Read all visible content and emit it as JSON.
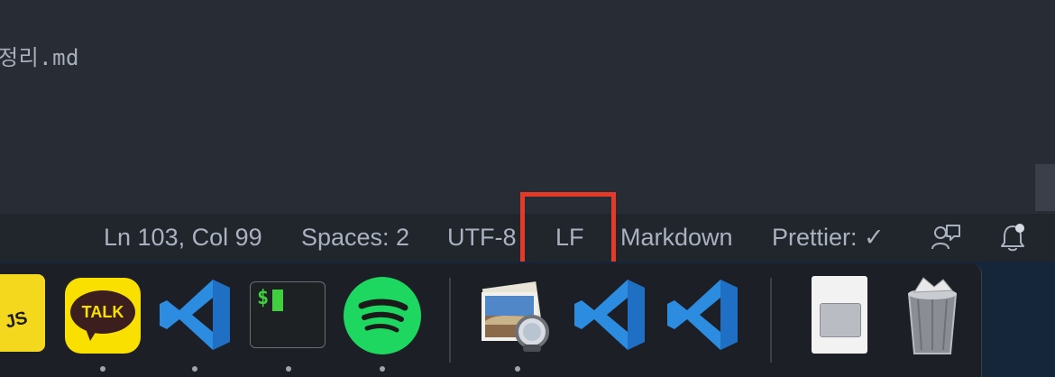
{
  "editor": {
    "visible_line": "정리.md"
  },
  "status_bar": {
    "position": "Ln 103, Col 99",
    "indentation": "Spaces: 2",
    "encoding": "UTF-8",
    "line_ending": "LF",
    "language_mode": "Markdown",
    "formatter": "Prettier: ✓",
    "feedback_icon": "feedback-person-icon",
    "notifications_icon": "bell-notification-icon"
  },
  "highlight": {
    "target": "line_ending",
    "color": "#e5392a"
  },
  "dock": {
    "apps": [
      {
        "name": "JS",
        "icon": "javascript-app-icon",
        "running": false
      },
      {
        "name": "TALK",
        "icon": "kakaotalk-icon",
        "running": true
      },
      {
        "name": "Visual Studio Code",
        "icon": "vscode-icon",
        "running": true
      },
      {
        "name": "Terminal",
        "icon": "terminal-icon",
        "running": true,
        "prompt": "$"
      },
      {
        "name": "Spotify",
        "icon": "spotify-icon",
        "running": true
      },
      {
        "name": "Preview",
        "icon": "preview-icon",
        "running": true
      },
      {
        "name": "Visual Studio Code",
        "icon": "vscode-icon",
        "running": false
      },
      {
        "name": "Visual Studio Code",
        "icon": "vscode-icon",
        "running": false
      },
      {
        "name": "Downloads",
        "icon": "document-stack-icon",
        "running": false
      },
      {
        "name": "Trash",
        "icon": "trash-icon",
        "running": false
      }
    ]
  },
  "colors": {
    "editor_bg": "#282c35",
    "statusbar_bg": "#21252c",
    "statusbar_text": "#aab1bf",
    "dock_bg": "#1c1f26",
    "vscode_blue": "#2c8ce0"
  }
}
